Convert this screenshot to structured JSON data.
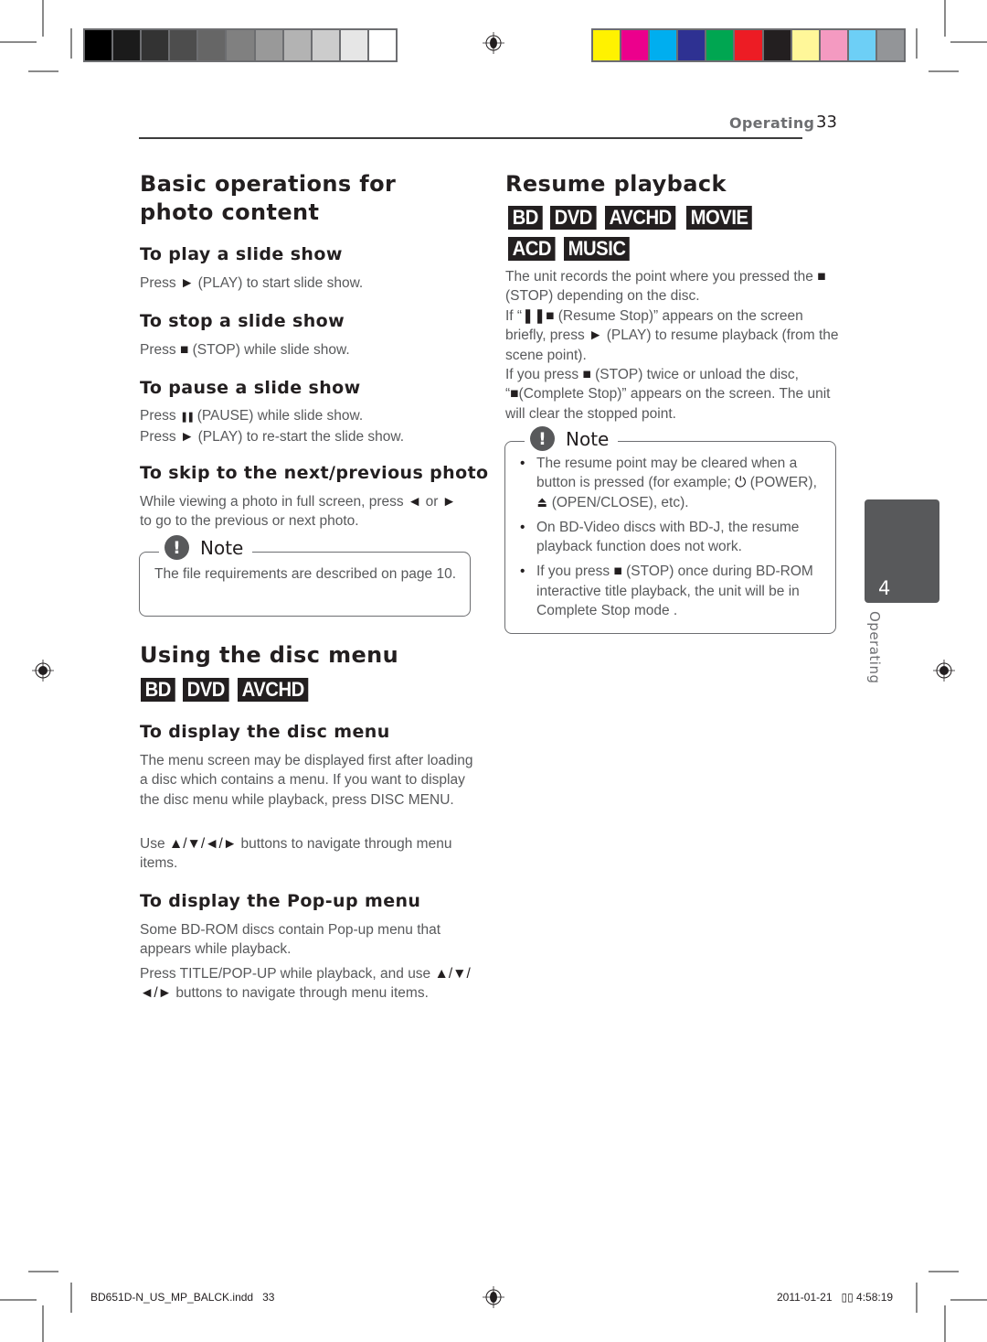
{
  "print_marks": {
    "gray_swatches": [
      "#000000",
      "#1b1b1b",
      "#333333",
      "#4d4d4d",
      "#666666",
      "#808080",
      "#999999",
      "#b3b3b3",
      "#cccccc",
      "#e6e6e6",
      "#ffffff"
    ],
    "color_swatches": [
      "#fff200",
      "#ec008c",
      "#00aeef",
      "#2e3192",
      "#00a651",
      "#ed1c24",
      "#231f20",
      "#fff799",
      "#f49ac1",
      "#6dcff6",
      "#939598"
    ]
  },
  "header": {
    "section": "Operating",
    "page_number": "33"
  },
  "side_tab": {
    "chapter_number": "4",
    "chapter_label": "Operating"
  },
  "left": {
    "photo": {
      "title": "Basic operations for photo content",
      "subsections": [
        {
          "heading": "To play a slide show",
          "lines": [
            {
              "pre": "Press",
              "icon": "►",
              "post": "(PLAY) to start slide show."
            }
          ]
        },
        {
          "heading": "To stop a slide show",
          "lines": [
            {
              "pre": "Press",
              "icon": "■",
              "post": "(STOP) while slide show."
            }
          ]
        },
        {
          "heading": "To pause a slide show",
          "lines": [
            {
              "pre": "Press",
              "icon": "❚❚",
              "post": "(PAUSE) while slide show."
            },
            {
              "pre": "Press",
              "icon": "►",
              "post": "(PLAY) to re-start the slide show."
            }
          ]
        },
        {
          "heading": "To skip to the next/previous photo",
          "text1": "While viewing a photo in full screen, press",
          "icon1": "◄",
          "text2": "or",
          "icon2": "►",
          "text3": "to go to the previous or next photo."
        }
      ],
      "note": {
        "icon": "!",
        "label": "Note",
        "text": "The file requirements are described on page 10."
      }
    },
    "disc_menu": {
      "title": "Using the disc menu",
      "badges": [
        "BD",
        "DVD",
        "AVCHD"
      ],
      "display_heading": "To display the disc menu",
      "display_text": "The menu screen may be displayed first after loading a disc which contains a menu. If you want to display the disc menu while playback, press DISC MENU.",
      "nav_pre": "Use",
      "nav_icons": "▲/▼/◄/►",
      "nav_post": "buttons to navigate through menu items.",
      "popup_heading": "To display the Pop-up menu",
      "popup_text1": "Some BD-ROM discs contain Pop-up menu that appears while playback.",
      "popup_text2_pre": "Press TITLE/POP-UP while playback, and use",
      "popup_icons_a": "▲/▼/",
      "popup_icons_b": "◄/►",
      "popup_text2_post": "buttons to navigate through menu items."
    }
  },
  "right": {
    "resume": {
      "title": "Resume playback",
      "badges": [
        "BD",
        "DVD",
        "AVCHD",
        "MOVIE",
        "ACD",
        "MUSIC"
      ],
      "p1_pre": "The unit records the point where you pressed the",
      "p1_icon": "■",
      "p1_post": "(STOP) depending on the disc.",
      "p2_pre": "If “",
      "p2_icon": "❚❚■",
      "p2_mid": "(Resume Stop)” appears on the screen briefly, press",
      "p2_icon2": "►",
      "p2_post": "(PLAY) to resume playback (from the scene point).",
      "p3_pre": "If you press",
      "p3_icon": "■",
      "p3_mid": "(STOP) twice or unload the disc, “",
      "p3_icon2": "■",
      "p3_post": "(Complete Stop)” appears on the screen. The unit will clear the stopped point."
    },
    "note": {
      "icon": "!",
      "label": "Note",
      "items": [
        {
          "pre": "The resume point may be cleared when a button is pressed (for example;",
          "icon1": "⏻",
          "mid": "(POWER),",
          "icon2": "⏏",
          "post": "(OPEN/CLOSE), etc)."
        },
        {
          "text": "On BD-Video discs with BD-J, the resume playback function does not work."
        },
        {
          "pre": "If you press",
          "icon1": "■",
          "post": "(STOP) once during BD-ROM interactive title playback, the unit will be in Complete Stop mode ."
        }
      ]
    }
  },
  "footer": {
    "filename": "BD651D-N_US_MP_BALCK.indd   33",
    "timestamp": "2011-01-21   ▯▯ 4:58:19"
  }
}
